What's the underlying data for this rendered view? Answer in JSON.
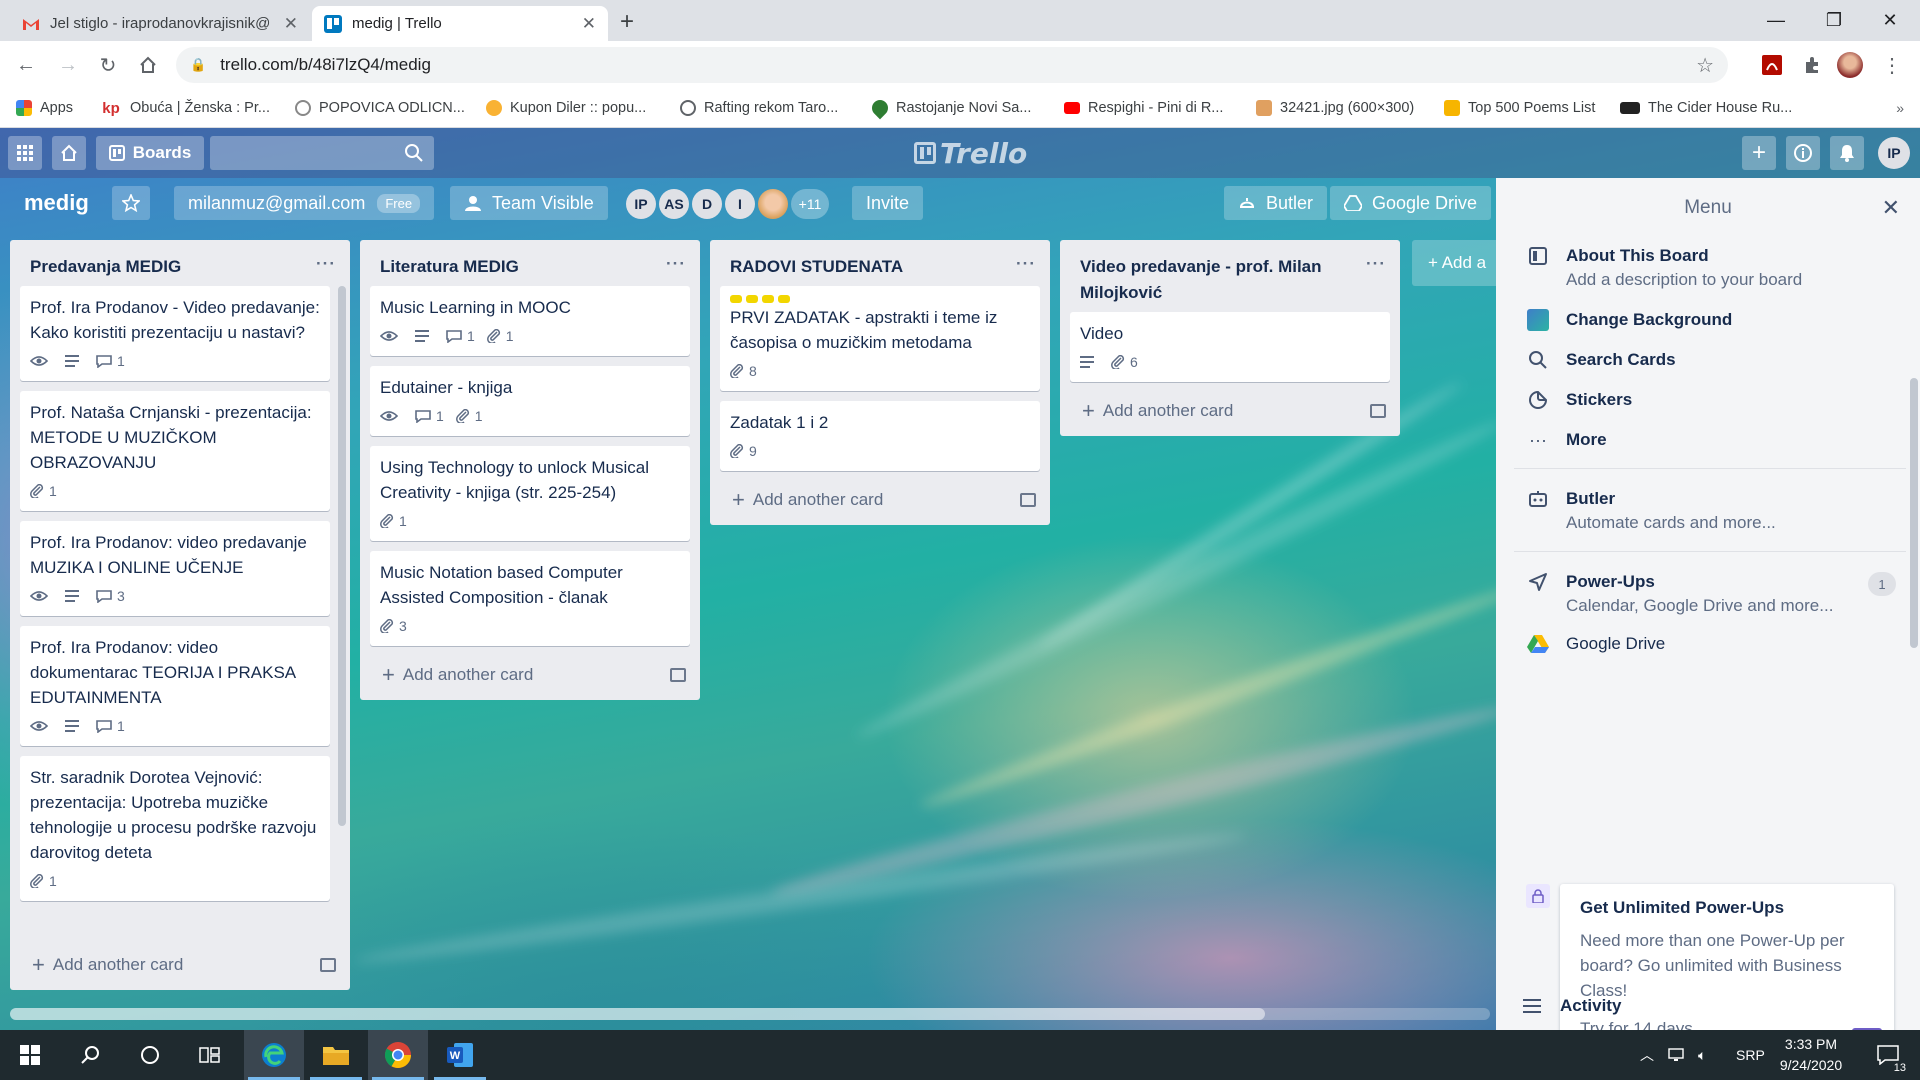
{
  "browser": {
    "tabs": [
      {
        "title": "Jel stiglo - iraprodanovkrajisnik@",
        "active": false,
        "icon": "gmail-icon"
      },
      {
        "title": "medig | Trello",
        "active": true,
        "icon": "trello-icon"
      }
    ],
    "url": "trello.com/b/48i7lzQ4/medig",
    "bookmarks": [
      {
        "label": "Apps",
        "icon": "apps-grid-icon"
      },
      {
        "label": "Obuća | Ženska : Pr...",
        "icon": "kp-icon"
      },
      {
        "label": "POPOVICA ODLICN...",
        "icon": "site-icon"
      },
      {
        "label": "Kupon Diler :: popu...",
        "icon": "coupon-icon"
      },
      {
        "label": "Rafting rekom Taro...",
        "icon": "globe-icon"
      },
      {
        "label": "Rastojanje Novi Sa...",
        "icon": "pin-icon"
      },
      {
        "label": "Respighi - Pini di R...",
        "icon": "youtube-icon"
      },
      {
        "label": "32421.jpg (600×300)",
        "icon": "image-icon"
      },
      {
        "label": "Top 500 Poems List",
        "icon": "poem-icon"
      },
      {
        "label": "The Cider House Ru...",
        "icon": "imdb-icon"
      }
    ],
    "bookmarks_more": "»"
  },
  "trello": {
    "top": {
      "boards_label": "Boards",
      "logo": "Trello",
      "user_initials": "IP"
    },
    "board": {
      "title": "medig",
      "workspace": "milanmuz@gmail.com",
      "plan": "Free",
      "visibility": "Team Visible",
      "members": [
        "IP",
        "AS",
        "D",
        "I"
      ],
      "members_more": "+11",
      "invite": "Invite",
      "butler": "Butler",
      "google_drive": "Google Drive"
    },
    "lists": [
      {
        "title": "Predavanja MEDIG",
        "cards": [
          {
            "text": "Prof. Ira Prodanov - Video predavanje: Kako koristiti prezentaciju u nastavi?",
            "watch": true,
            "desc": true,
            "comments": "1"
          },
          {
            "text": "Prof. Nataša Crnjanski - prezentacija: METODE U MUZIČKOM OBRAZOVANJU",
            "attachments": "1"
          },
          {
            "text": "Prof. Ira Prodanov: video predavanje MUZIKA I ONLINE UČENJE",
            "watch": true,
            "desc": true,
            "comments": "3"
          },
          {
            "text": "Prof. Ira Prodanov: video dokumentarac TEORIJA I PRAKSA EDUTAINMENTA",
            "watch": true,
            "desc": true,
            "comments": "1"
          },
          {
            "text": "Str. saradnik Dorotea Vejnović: prezentacija: Upotreba muzičke tehnologije u procesu podrške razvoju darovitog deteta",
            "attachments": "1"
          }
        ]
      },
      {
        "title": "Literatura MEDIG",
        "cards": [
          {
            "text": "Music Learning in MOOC",
            "watch": true,
            "desc": true,
            "comments": "1",
            "attachments": "1"
          },
          {
            "text": "Edutainer - knjiga",
            "watch": true,
            "comments": "1",
            "attachments": "1"
          },
          {
            "text": "Using Technology to unlock Musical Creativity - knjiga (str. 225-254)",
            "attachments": "1"
          },
          {
            "text": "Music Notation based Computer Assisted Composition - članak",
            "attachments": "3"
          }
        ]
      },
      {
        "title": "RADOVI STUDENATA",
        "cards": [
          {
            "text": "PRVI ZADATAK - apstrakti i teme iz časopisa o muzičkim metodama",
            "attachments": "8",
            "labels": true
          },
          {
            "text": "Zadatak 1 i 2",
            "attachments": "9"
          }
        ]
      },
      {
        "title": "Video predavanje - prof. Milan Milojković",
        "cards": [
          {
            "text": "Video",
            "desc": true,
            "attachments": "6"
          }
        ]
      }
    ],
    "add_card": "Add another card",
    "add_list": "+ Add a",
    "menu": {
      "title": "Menu",
      "about": {
        "title": "About This Board",
        "sub": "Add a description to your board"
      },
      "change_bg": "Change Background",
      "search_cards": "Search Cards",
      "stickers": "Stickers",
      "more": "More",
      "butler": {
        "title": "Butler",
        "sub": "Automate cards and more..."
      },
      "powerups": {
        "title": "Power-Ups",
        "sub": "Calendar, Google Drive and more...",
        "count": "1"
      },
      "google_drive": "Google Drive",
      "upsell": {
        "title": "Get Unlimited Power-Ups",
        "desc": "Need more than one Power-Up per board? Go unlimited with Business Class!",
        "link": "Try for 14 days"
      },
      "activity": "Activity"
    }
  },
  "taskbar": {
    "lang": "SRP",
    "time": "3:33 PM",
    "date": "9/24/2020",
    "notifications": "13"
  },
  "colors": {
    "list_bg": "#ebecf0",
    "menu_bg": "#f4f5f7",
    "powerup_purple": "#6e5dc6",
    "taskbar": "#1f2a2f"
  }
}
